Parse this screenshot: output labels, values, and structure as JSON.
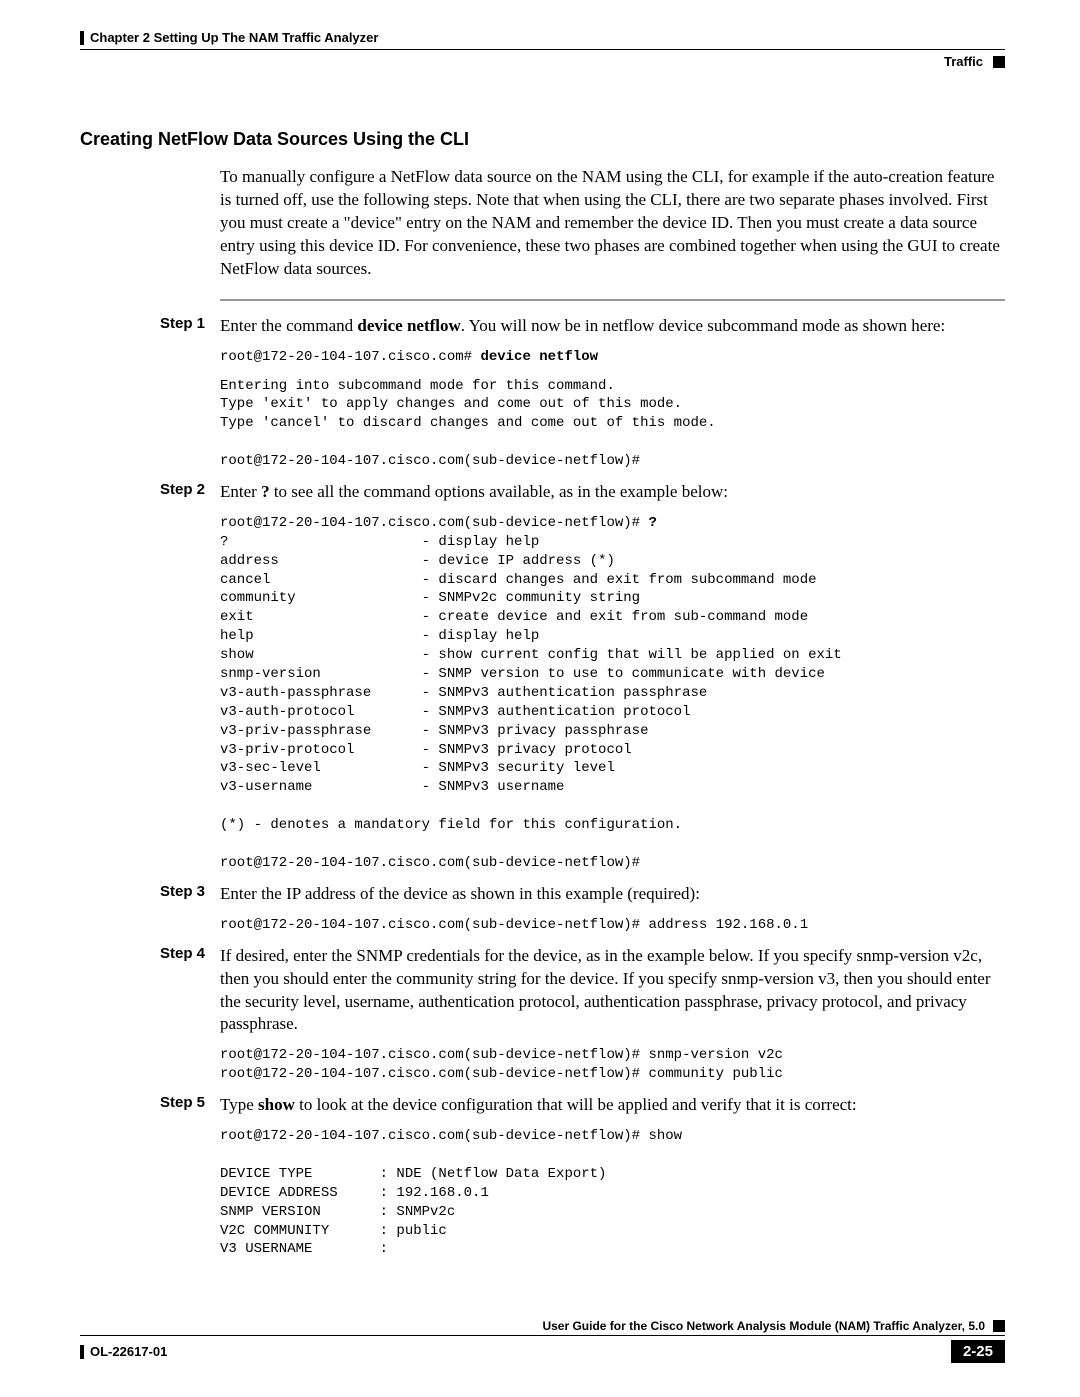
{
  "header": {
    "chapter": "Chapter 2      Setting Up The NAM Traffic Analyzer",
    "section": "Traffic"
  },
  "title": "Creating NetFlow Data Sources Using the CLI",
  "intro": "To manually configure a NetFlow data source on the NAM using the CLI, for example if the auto-creation feature is turned off, use the following steps. Note that when using the CLI, there are two separate phases involved. First you must create a \"device\" entry on the NAM and remember the device ID. Then you must create a data source entry using this device ID. For convenience, these two phases are combined together when using the GUI to create NetFlow data sources.",
  "steps": {
    "s1": {
      "label": "Step 1",
      "text_a": "Enter the command ",
      "cmd": "device netflow",
      "text_b": ". You will now be in netflow device subcommand mode as shown here:",
      "cli1_prefix": "root@172-20-104-107.cisco.com# ",
      "cli1_cmd": "device netflow",
      "cli2": "Entering into subcommand mode for this command.\nType 'exit' to apply changes and come out of this mode.\nType 'cancel' to discard changes and come out of this mode.\n\nroot@172-20-104-107.cisco.com(sub-device-netflow)#"
    },
    "s2": {
      "label": "Step 2",
      "text_a": "Enter ",
      "cmd": "?",
      "text_b": " to see all the command options available, as in the example below:",
      "cli_prefix": "root@172-20-104-107.cisco.com(sub-device-netflow)# ",
      "cli_cmd": "?",
      "cli_body": "?                       - display help\naddress                 - device IP address (*)\ncancel                  - discard changes and exit from subcommand mode\ncommunity               - SNMPv2c community string\nexit                    - create device and exit from sub-command mode\nhelp                    - display help\nshow                    - show current config that will be applied on exit\nsnmp-version            - SNMP version to use to communicate with device\nv3-auth-passphrase      - SNMPv3 authentication passphrase\nv3-auth-protocol        - SNMPv3 authentication protocol\nv3-priv-passphrase      - SNMPv3 privacy passphrase\nv3-priv-protocol        - SNMPv3 privacy protocol\nv3-sec-level            - SNMPv3 security level\nv3-username             - SNMPv3 username\n\n(*) - denotes a mandatory field for this configuration.\n\nroot@172-20-104-107.cisco.com(sub-device-netflow)#"
    },
    "s3": {
      "label": "Step 3",
      "text": "Enter the IP address of the device as shown in this example (required):",
      "cli": "root@172-20-104-107.cisco.com(sub-device-netflow)# address 192.168.0.1"
    },
    "s4": {
      "label": "Step 4",
      "text": "If desired, enter the SNMP credentials for the device, as in the example below.  If you specify snmp-version v2c, then you should enter the community string for the device.  If you specify snmp-version v3, then you should enter the security level, username, authentication protocol, authentication passphrase, privacy protocol, and privacy passphrase.",
      "cli": "root@172-20-104-107.cisco.com(sub-device-netflow)# snmp-version v2c\nroot@172-20-104-107.cisco.com(sub-device-netflow)# community public"
    },
    "s5": {
      "label": "Step 5",
      "text_a": "Type ",
      "cmd": "show",
      "text_b": " to look at the device configuration that will be applied and verify that it is correct:",
      "cli": "root@172-20-104-107.cisco.com(sub-device-netflow)# show\n\nDEVICE TYPE        : NDE (Netflow Data Export)\nDEVICE ADDRESS     : 192.168.0.1\nSNMP VERSION       : SNMPv2c\nV2C COMMUNITY      : public\nV3 USERNAME        :"
    }
  },
  "footer": {
    "guide": "User Guide for the Cisco Network Analysis Module (NAM) Traffic Analyzer, 5.0",
    "doc_id": "OL-22617-01",
    "page": "2-25"
  }
}
